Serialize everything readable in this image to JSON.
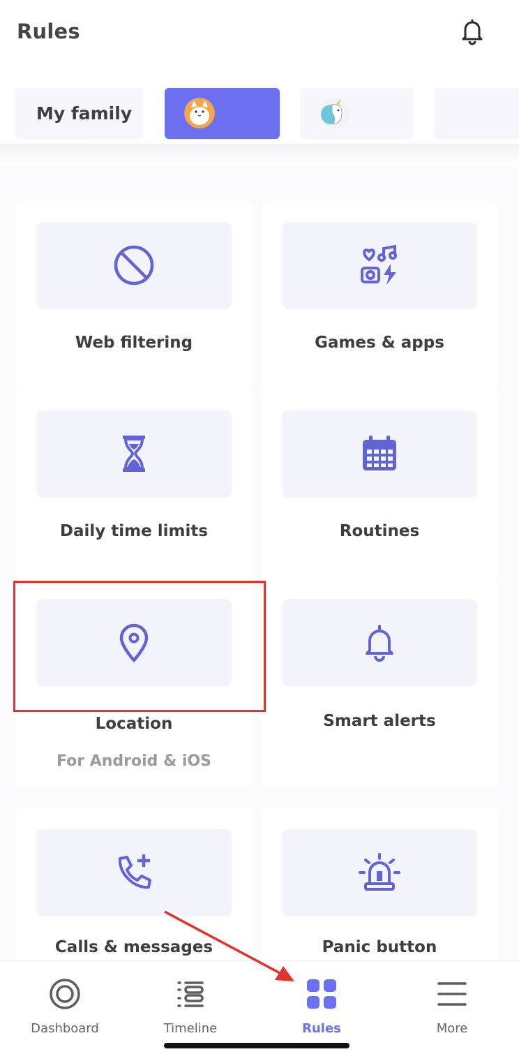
{
  "header": {
    "title": "Rules",
    "bell_icon": "bell-icon"
  },
  "tabs": [
    {
      "label": "My family",
      "selected": false
    },
    {
      "label": "",
      "avatar": "cat-avatar",
      "selected": true
    },
    {
      "label": "",
      "avatar": "unicorn-avatar",
      "selected": false
    },
    {
      "label": "",
      "selected": false
    }
  ],
  "rules": [
    {
      "label": "Web filtering",
      "icon": "block-icon"
    },
    {
      "label": "Games & apps",
      "icon": "games-apps-icon"
    },
    {
      "label": "Daily time limits",
      "icon": "hourglass-icon"
    },
    {
      "label": "Routines",
      "icon": "calendar-icon"
    },
    {
      "label": "Location",
      "sub": "For Android & iOS",
      "icon": "location-pin-icon",
      "highlighted": true
    },
    {
      "label": "Smart alerts",
      "icon": "bell-icon"
    },
    {
      "label": "Calls & messages",
      "icon": "phone-plus-icon"
    },
    {
      "label": "Panic button",
      "icon": "siren-icon"
    }
  ],
  "nav": [
    {
      "label": "Dashboard",
      "icon": "dashboard-icon",
      "active": false
    },
    {
      "label": "Timeline",
      "icon": "timeline-icon",
      "active": false
    },
    {
      "label": "Rules",
      "icon": "rules-grid-icon",
      "active": true
    },
    {
      "label": "More",
      "icon": "menu-icon",
      "active": false
    }
  ],
  "colors": {
    "accent": "#6c6ff0",
    "highlight": "#e0332b"
  }
}
